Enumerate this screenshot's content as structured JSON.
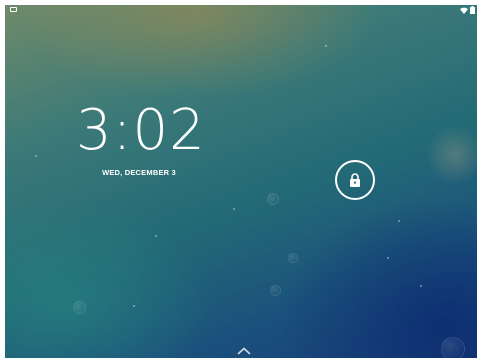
{
  "lockscreen": {
    "time": "3:02",
    "date": "WED, DECEMBER 3"
  },
  "status_bar": {
    "left_icon": "image-notification-icon",
    "right_icons": [
      "wifi-icon",
      "battery-icon"
    ]
  },
  "unlock": {
    "icon": "lock-icon"
  },
  "bottom_hint": {
    "icon": "chevron-up-icon"
  },
  "colors": {
    "text": "#ffffff",
    "wallpaper_top": "#6e8a6a",
    "wallpaper_mid": "#236a76",
    "wallpaper_bottom": "#183e7a"
  }
}
